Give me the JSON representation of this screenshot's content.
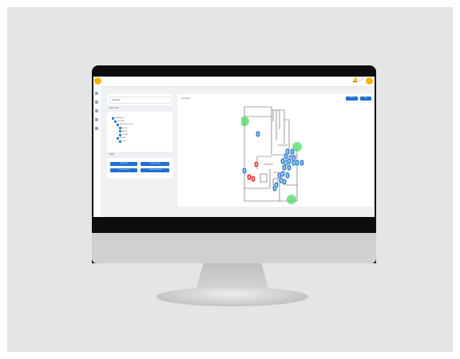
{
  "colors": {
    "accent": "#1f6fd1",
    "logo": "#f5b400",
    "alarm": "#e53935",
    "online": "#4cd964",
    "device": "#2b7bd0"
  },
  "app": {
    "logo_icon": "brand-logo-icon",
    "topbar_icons": "bell-icon expand-icon"
  },
  "left_panel": {
    "site_select": "Shopfloor",
    "floor_tree_header": "Floor Tree",
    "tree": [
      {
        "label": "Building main",
        "level": 0
      },
      {
        "label": "Floor plan",
        "level": 1
      },
      {
        "label": "Warehouse & Yard",
        "level": 2
      },
      {
        "label": "Area A",
        "level": 3
      },
      {
        "label": "Area B",
        "level": 3
      },
      {
        "label": "Corridor",
        "level": 3
      },
      {
        "label": "Ground",
        "level": 2
      },
      {
        "label": "Line 1",
        "level": 3
      }
    ],
    "tools_header": "Tools",
    "buttons": {
      "add_device": "+ Add Device",
      "update_device": "+ Update Device",
      "delete_device": "− Delete Device",
      "export": "↓ Export Floor Plan"
    }
  },
  "map_panel": {
    "title": "Location",
    "save_label": "Save",
    "edit_label": "Edit"
  },
  "markers": {
    "blue_count": 22,
    "red_count": 3,
    "green_count": 3
  }
}
